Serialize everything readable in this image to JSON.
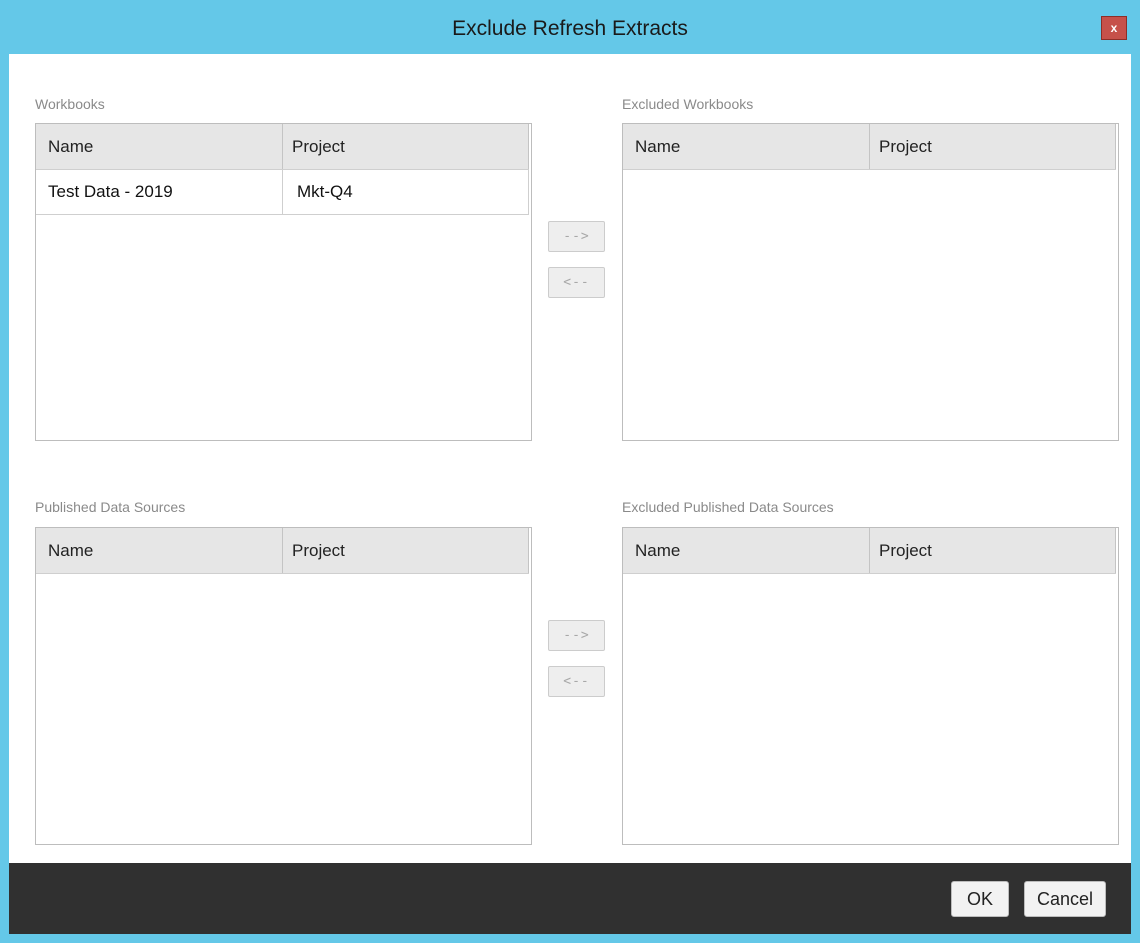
{
  "window": {
    "title": "Exclude Refresh Extracts",
    "close_label": "x"
  },
  "columns": {
    "name": "Name",
    "project": "Project"
  },
  "workbooks": {
    "label": "Workbooks",
    "rows": [
      {
        "name": "Test Data - 2019",
        "project": "Mkt-Q4"
      }
    ]
  },
  "excluded_workbooks": {
    "label": "Excluded Workbooks",
    "rows": []
  },
  "published_data_sources": {
    "label": "Published Data Sources",
    "rows": []
  },
  "excluded_published_data_sources": {
    "label": "Excluded Published Data Sources",
    "rows": []
  },
  "move_buttons": {
    "add_label": "-->",
    "remove_label": "<--"
  },
  "footer": {
    "ok_label": "OK",
    "cancel_label": "Cancel"
  },
  "colors": {
    "title_bar": "#64c8e8",
    "close_button": "#c6514a",
    "footer_bar": "#303030"
  }
}
